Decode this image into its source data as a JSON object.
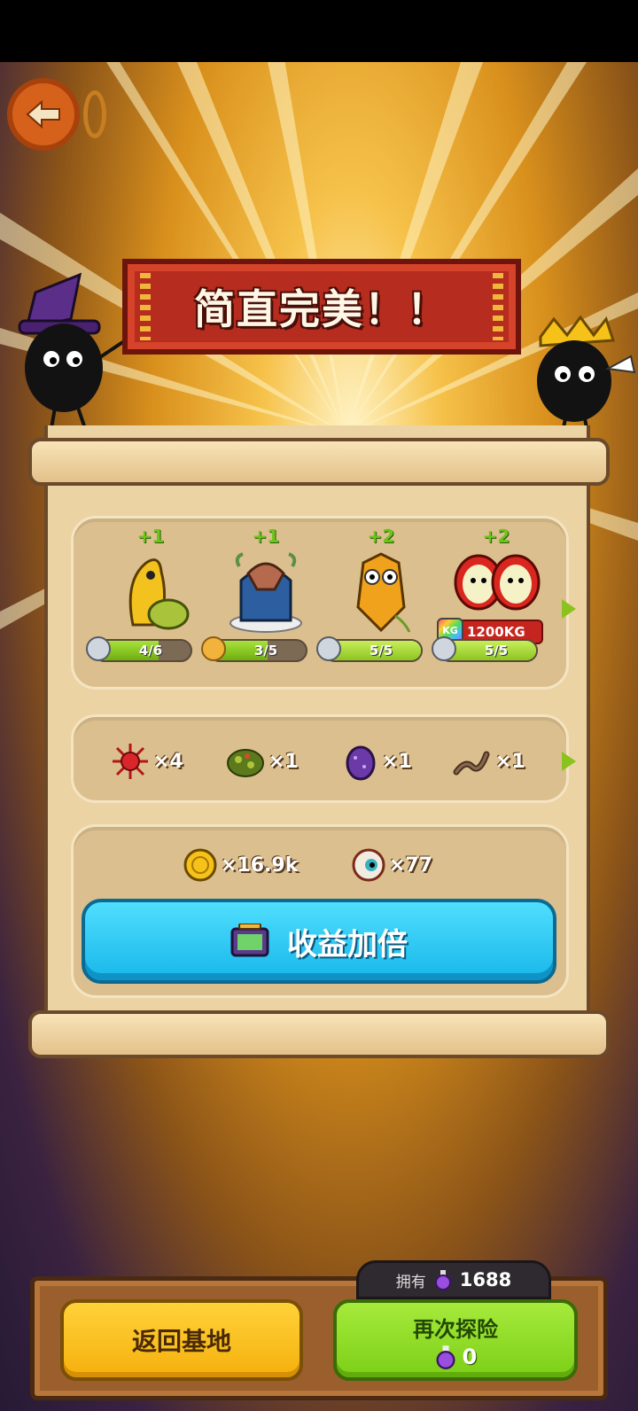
{
  "banner": {
    "title": "简直完美！！"
  },
  "creatures": [
    {
      "name": "yellow-banana-creature",
      "plus": "+1",
      "progress_text": "4/6",
      "progress": 0.667,
      "icon": "gray-monster-icon"
    },
    {
      "name": "blue-octopus-creature",
      "plus": "+1",
      "progress_text": "3/5",
      "progress": 0.6,
      "icon": "orange-monster-icon"
    },
    {
      "name": "pineapple-owl-creature",
      "plus": "+2",
      "progress_text": "5/5",
      "progress": 1.0,
      "icon": "gray-monster-icon"
    },
    {
      "name": "apple-twins-creature",
      "plus": "+2",
      "progress_text": "5/5",
      "progress": 1.0,
      "icon": "gray-monster-icon",
      "weight": "1200KG",
      "weight_icon": "KG"
    }
  ],
  "items": [
    {
      "name": "red-spiky-item",
      "count": "×4"
    },
    {
      "name": "moss-clump-item",
      "count": "×1"
    },
    {
      "name": "purple-egg-item",
      "count": "×1"
    },
    {
      "name": "worm-item",
      "count": "×1"
    }
  ],
  "rewards": [
    {
      "name": "gold-coin",
      "count": "×16.9k"
    },
    {
      "name": "eyeball",
      "count": "×77"
    }
  ],
  "double_button": {
    "label": "收益加倍"
  },
  "owned": {
    "label": "拥有",
    "value": "1688"
  },
  "buttons": {
    "return_label": "返回基地",
    "again_label": "再次探险",
    "again_cost": "0"
  },
  "colors": {
    "accent_blue": "#17b7ea",
    "accent_green": "#7ccf16",
    "accent_yellow": "#f5b00c",
    "banner_red": "#b62c1f"
  }
}
